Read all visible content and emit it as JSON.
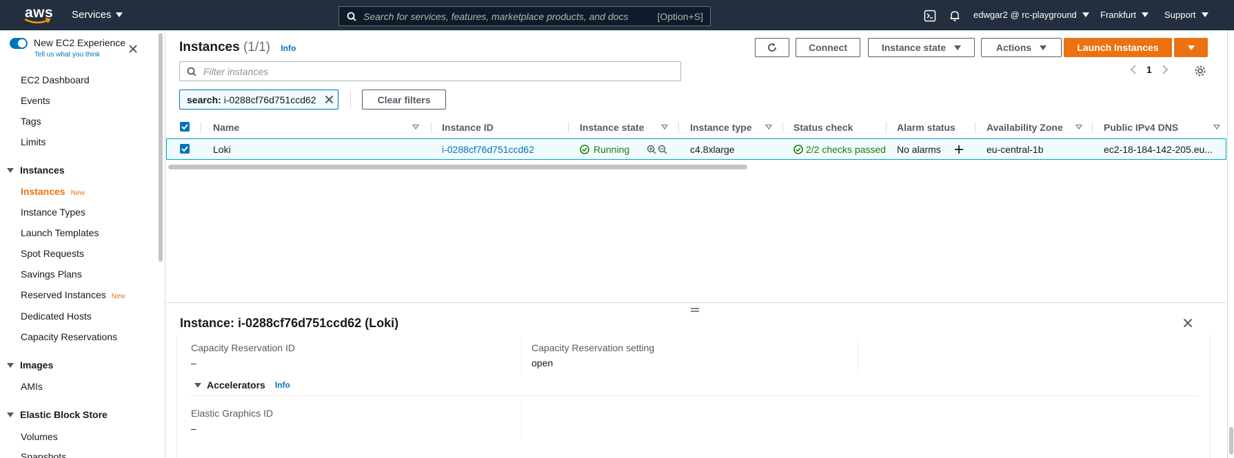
{
  "topbar": {
    "logo_text": "aws",
    "services_label": "Services",
    "search_placeholder": "Search for services, features, marketplace products, and docs",
    "search_shortcut": "[Option+S]",
    "account_label": "edwgar2 @ rc-playground",
    "region_label": "Frankfurt",
    "support_label": "Support"
  },
  "sidebar": {
    "toggle_label": "New EC2 Experience",
    "toggle_sub": "Tell us what you think",
    "items": [
      {
        "label": "EC2 Dashboard"
      },
      {
        "label": "Events"
      },
      {
        "label": "Tags"
      },
      {
        "label": "Limits"
      }
    ],
    "sections": [
      {
        "label": "Instances",
        "items": [
          {
            "label": "Instances",
            "badge": "New",
            "active": true
          },
          {
            "label": "Instance Types"
          },
          {
            "label": "Launch Templates"
          },
          {
            "label": "Spot Requests"
          },
          {
            "label": "Savings Plans"
          },
          {
            "label": "Reserved Instances",
            "badge": "New"
          },
          {
            "label": "Dedicated Hosts"
          },
          {
            "label": "Capacity Reservations"
          }
        ]
      },
      {
        "label": "Images",
        "items": [
          {
            "label": "AMIs"
          }
        ]
      },
      {
        "label": "Elastic Block Store",
        "items": [
          {
            "label": "Volumes"
          },
          {
            "label": "Snapshots"
          }
        ]
      }
    ]
  },
  "main": {
    "title": "Instances",
    "count": "(1/1)",
    "info": "Info",
    "buttons": {
      "connect": "Connect",
      "instance_state": "Instance state",
      "actions": "Actions",
      "launch": "Launch Instances"
    },
    "filter_placeholder": "Filter instances",
    "page_number": "1",
    "token": {
      "key": "search:",
      "value": "i-0288cf76d751ccd62"
    },
    "clear_filters": "Clear filters"
  },
  "table": {
    "columns": [
      "Name",
      "Instance ID",
      "Instance state",
      "Instance type",
      "Status check",
      "Alarm status",
      "Availability Zone",
      "Public IPv4 DNS"
    ],
    "rows": [
      {
        "name": "Loki",
        "instance_id": "i-0288cf76d751ccd62",
        "state": "Running",
        "type": "c4.8xlarge",
        "status_check": "2/2 checks passed",
        "alarm": "No alarms",
        "az": "eu-central-1b",
        "dns": "ec2-18-184-142-205.eu..."
      }
    ]
  },
  "details": {
    "title": "Instance: i-0288cf76d751ccd62 (Loki)",
    "capacity_reservation_id_label": "Capacity Reservation ID",
    "capacity_reservation_id_value": "–",
    "capacity_reservation_setting_label": "Capacity Reservation setting",
    "capacity_reservation_setting_value": "open",
    "accelerators_label": "Accelerators",
    "accelerators_info": "Info",
    "elastic_graphics_label": "Elastic Graphics ID",
    "elastic_graphics_value": "–"
  },
  "colors": {
    "topbar_bg": "#232f3e",
    "accent_orange": "#ec7211",
    "link_blue": "#0073bb",
    "success_green": "#1d8102",
    "selected_row_bg": "#f1faff"
  }
}
